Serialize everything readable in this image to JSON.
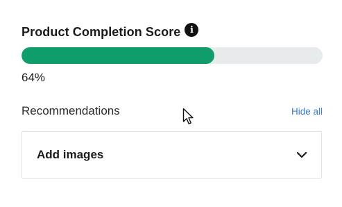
{
  "score": {
    "title": "Product Completion Score",
    "info_icon": "info-icon",
    "percent_value": 64,
    "percent_label": "64%",
    "bar_color": "#0f9d6b",
    "track_color": "#e8ebec"
  },
  "recommendations": {
    "title": "Recommendations",
    "hide_all_label": "Hide all",
    "link_color": "#3d7bd6",
    "items": [
      {
        "label": "Add images",
        "icon": "chevron-down-icon",
        "expanded": false
      }
    ]
  },
  "pointer": {
    "icon": "mouse-cursor-icon"
  }
}
